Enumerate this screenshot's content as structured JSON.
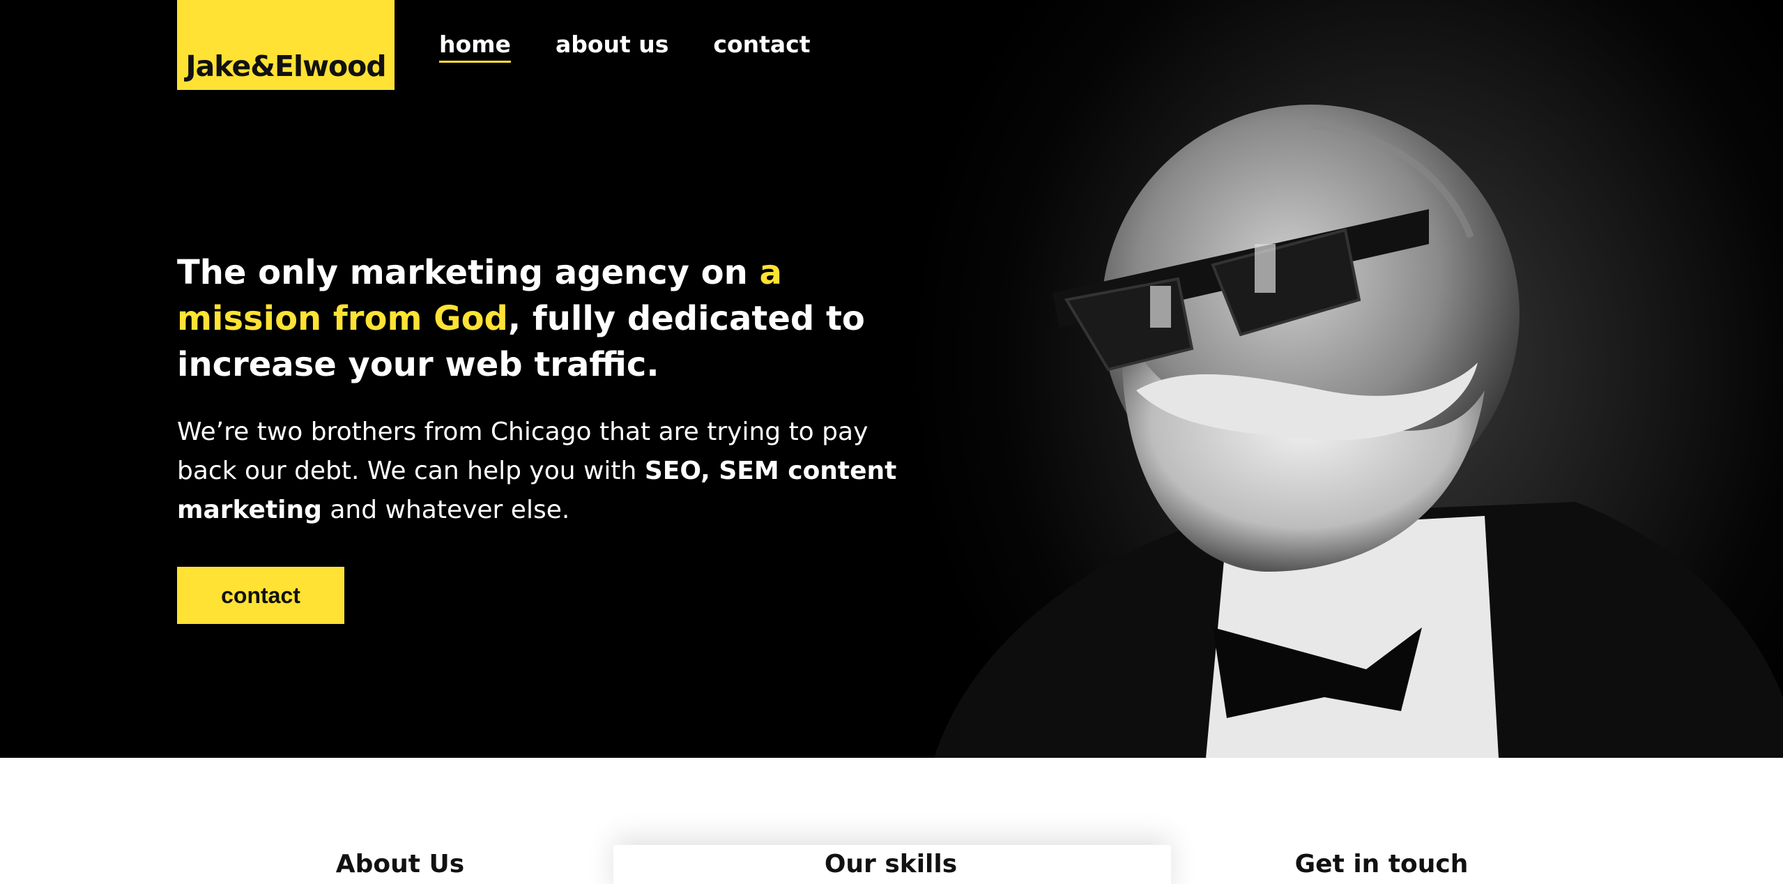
{
  "brand": {
    "logo_text": "Jake&Elwood",
    "accent": "#ffe234"
  },
  "nav": {
    "items": [
      "home",
      "about us",
      "contact"
    ],
    "active": "home"
  },
  "hero": {
    "headline_part1": "The only marketing agency on ",
    "headline_highlight": "a mission from God",
    "headline_part2": ", fully dedicated to increase your web traffic.",
    "lead_part1": "We’re two brothers from Chicago that are trying to pay back our debt. We can help you with ",
    "lead_bold": "SEO, SEM content marketing",
    "lead_part2": " and whatever else.",
    "cta_label": "contact"
  },
  "sections": {
    "about": "About Us",
    "skills": "Our skills",
    "contact": "Get in touch"
  }
}
